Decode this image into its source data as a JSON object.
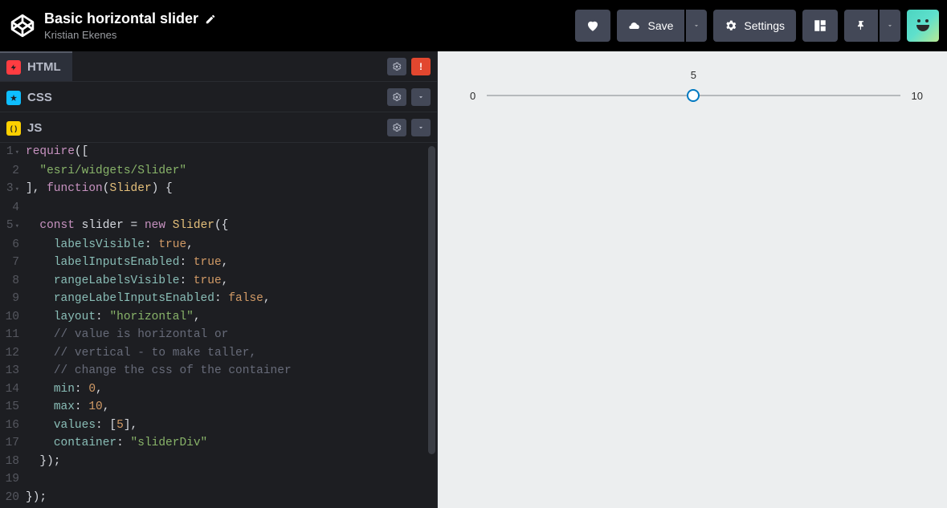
{
  "header": {
    "title": "Basic horizontal slider",
    "author": "Kristian Ekenes",
    "save_label": "Save",
    "settings_label": "Settings"
  },
  "panels": {
    "html": {
      "label": "HTML"
    },
    "css": {
      "label": "CSS"
    },
    "js": {
      "label": "JS"
    }
  },
  "code": {
    "lines": [
      {
        "n": "1",
        "fold": true,
        "segs": [
          [
            "kw",
            "require"
          ],
          [
            "punc",
            "(["
          ]
        ]
      },
      {
        "n": "2",
        "fold": false,
        "segs": [
          [
            "plain",
            "  "
          ],
          [
            "str",
            "\"esri/widgets/Slider\""
          ]
        ]
      },
      {
        "n": "3",
        "fold": true,
        "segs": [
          [
            "punc",
            "], "
          ],
          [
            "kw",
            "function"
          ],
          [
            "punc",
            "("
          ],
          [
            "class",
            "Slider"
          ],
          [
            "punc",
            ") {"
          ]
        ]
      },
      {
        "n": "4",
        "fold": false,
        "segs": [
          [
            "plain",
            ""
          ]
        ]
      },
      {
        "n": "5",
        "fold": true,
        "segs": [
          [
            "plain",
            "  "
          ],
          [
            "kw",
            "const"
          ],
          [
            "plain",
            " "
          ],
          [
            "name",
            "slider"
          ],
          [
            "plain",
            " "
          ],
          [
            "punc",
            "="
          ],
          [
            "plain",
            " "
          ],
          [
            "kw",
            "new"
          ],
          [
            "plain",
            " "
          ],
          [
            "class",
            "Slider"
          ],
          [
            "punc",
            "({"
          ]
        ]
      },
      {
        "n": "6",
        "fold": false,
        "segs": [
          [
            "plain",
            "    "
          ],
          [
            "prop",
            "labelsVisible"
          ],
          [
            "punc",
            ": "
          ],
          [
            "val",
            "true"
          ],
          [
            "punc",
            ","
          ]
        ]
      },
      {
        "n": "7",
        "fold": false,
        "segs": [
          [
            "plain",
            "    "
          ],
          [
            "prop",
            "labelInputsEnabled"
          ],
          [
            "punc",
            ": "
          ],
          [
            "val",
            "true"
          ],
          [
            "punc",
            ","
          ]
        ]
      },
      {
        "n": "8",
        "fold": false,
        "segs": [
          [
            "plain",
            "    "
          ],
          [
            "prop",
            "rangeLabelsVisible"
          ],
          [
            "punc",
            ": "
          ],
          [
            "val",
            "true"
          ],
          [
            "punc",
            ","
          ]
        ]
      },
      {
        "n": "9",
        "fold": false,
        "segs": [
          [
            "plain",
            "    "
          ],
          [
            "prop",
            "rangeLabelInputsEnabled"
          ],
          [
            "punc",
            ": "
          ],
          [
            "val",
            "false"
          ],
          [
            "punc",
            ","
          ]
        ]
      },
      {
        "n": "10",
        "fold": false,
        "segs": [
          [
            "plain",
            "    "
          ],
          [
            "prop",
            "layout"
          ],
          [
            "punc",
            ": "
          ],
          [
            "str",
            "\"horizontal\""
          ],
          [
            "punc",
            ","
          ]
        ]
      },
      {
        "n": "11",
        "fold": false,
        "segs": [
          [
            "plain",
            "    "
          ],
          [
            "comm",
            "// value is horizontal or"
          ]
        ]
      },
      {
        "n": "12",
        "fold": false,
        "segs": [
          [
            "plain",
            "    "
          ],
          [
            "comm",
            "// vertical - to make taller,"
          ]
        ]
      },
      {
        "n": "13",
        "fold": false,
        "segs": [
          [
            "plain",
            "    "
          ],
          [
            "comm",
            "// change the css of the container"
          ]
        ]
      },
      {
        "n": "14",
        "fold": false,
        "segs": [
          [
            "plain",
            "    "
          ],
          [
            "prop",
            "min"
          ],
          [
            "punc",
            ": "
          ],
          [
            "num",
            "0"
          ],
          [
            "punc",
            ","
          ]
        ]
      },
      {
        "n": "15",
        "fold": false,
        "segs": [
          [
            "plain",
            "    "
          ],
          [
            "prop",
            "max"
          ],
          [
            "punc",
            ": "
          ],
          [
            "num",
            "10"
          ],
          [
            "punc",
            ","
          ]
        ]
      },
      {
        "n": "16",
        "fold": false,
        "segs": [
          [
            "plain",
            "    "
          ],
          [
            "prop",
            "values"
          ],
          [
            "punc",
            ": ["
          ],
          [
            "num",
            "5"
          ],
          [
            "punc",
            "],"
          ]
        ]
      },
      {
        "n": "17",
        "fold": false,
        "segs": [
          [
            "plain",
            "    "
          ],
          [
            "prop",
            "container"
          ],
          [
            "punc",
            ": "
          ],
          [
            "str",
            "\"sliderDiv\""
          ]
        ]
      },
      {
        "n": "18",
        "fold": false,
        "segs": [
          [
            "plain",
            "  "
          ],
          [
            "punc",
            "});"
          ]
        ]
      },
      {
        "n": "19",
        "fold": false,
        "segs": [
          [
            "plain",
            ""
          ]
        ]
      },
      {
        "n": "20",
        "fold": false,
        "segs": [
          [
            "punc",
            "});"
          ]
        ]
      }
    ]
  },
  "preview": {
    "slider": {
      "min": "0",
      "max": "10",
      "value": "5",
      "percent": 50
    }
  }
}
